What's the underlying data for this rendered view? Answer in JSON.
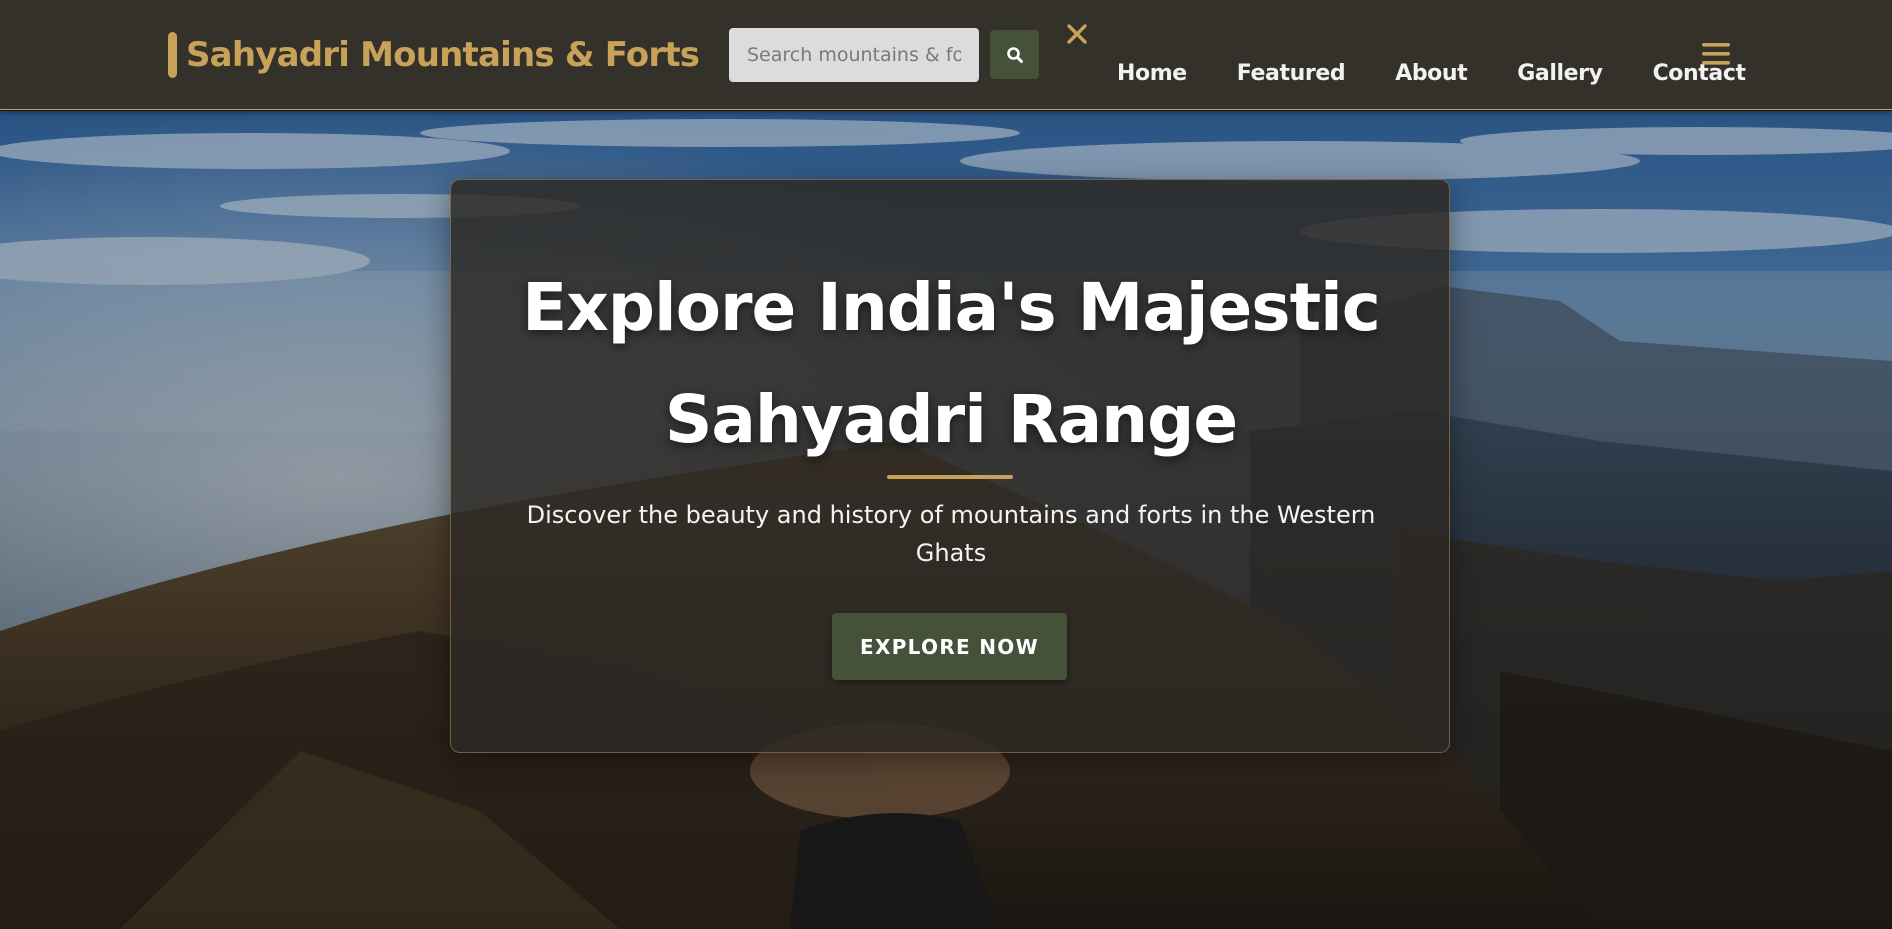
{
  "header": {
    "logo_text": "Sahyadri Mountains & Forts",
    "search": {
      "placeholder": "Search mountains & forts...",
      "value": ""
    },
    "search_button_icon": "search-icon",
    "close_icon": "close-icon",
    "menu_icon": "hamburger-menu-icon",
    "nav": [
      {
        "label": "Home"
      },
      {
        "label": "Featured"
      },
      {
        "label": "About"
      },
      {
        "label": "Gallery"
      },
      {
        "label": "Contact"
      }
    ]
  },
  "hero": {
    "title": "Explore India's Majestic Sahyadri Range",
    "subtitle": "Discover the beauty and history of mountains and forts in the Western Ghats",
    "button_label": "EXPLORE NOW",
    "background_image": "mountain-landscape-photo"
  },
  "colors": {
    "header_bg": "#34302a",
    "accent_gold": "#c9a25a",
    "button_green": "#46513a",
    "text_light": "#ffffff"
  }
}
